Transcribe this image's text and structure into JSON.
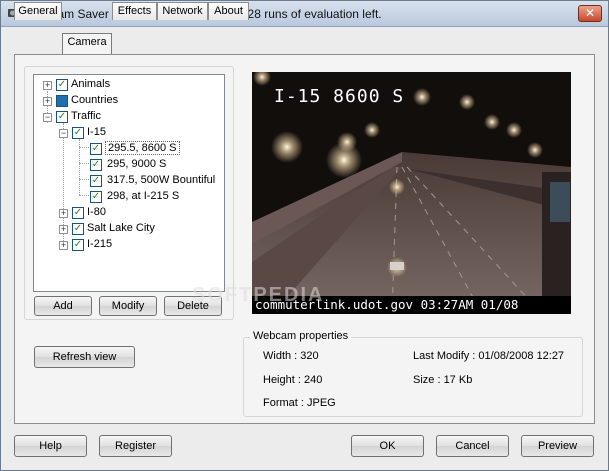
{
  "window": {
    "title": "Webcam Saver - Trial version - You have 28 runs of evaluation left."
  },
  "tabs": [
    "General",
    "Camera",
    "Effects",
    "Network",
    "About"
  ],
  "tree": {
    "animals": "Animals",
    "countries": "Countries",
    "traffic": "Traffic",
    "i15": "I-15",
    "cam1": "295.5, 8600 S",
    "cam2": "295, 9000 S",
    "cam3": "317.5, 500W Bountiful",
    "cam4": "298, at I-215 S",
    "i80": "I-80",
    "slc": "Salt Lake City",
    "i215": "I-215"
  },
  "tree_buttons": {
    "add": "Add",
    "modify": "Modify",
    "delete": "Delete"
  },
  "refresh_label": "Refresh view",
  "webcam": {
    "overlay_title": "I-15 8600 S",
    "caption": "commuterlink.udot.gov 03:27AM 01/08",
    "watermark": "SOFTPEDIA"
  },
  "properties": {
    "group_title": "Webcam properties",
    "width": "Width : 320",
    "height": "Height : 240",
    "format": "Format : JPEG",
    "last_modify": "Last Modify : 01/08/2008 12:27",
    "size": "Size : 17 Kb"
  },
  "footer": {
    "help": "Help",
    "register": "Register",
    "ok": "OK",
    "cancel": "Cancel",
    "preview": "Preview"
  }
}
